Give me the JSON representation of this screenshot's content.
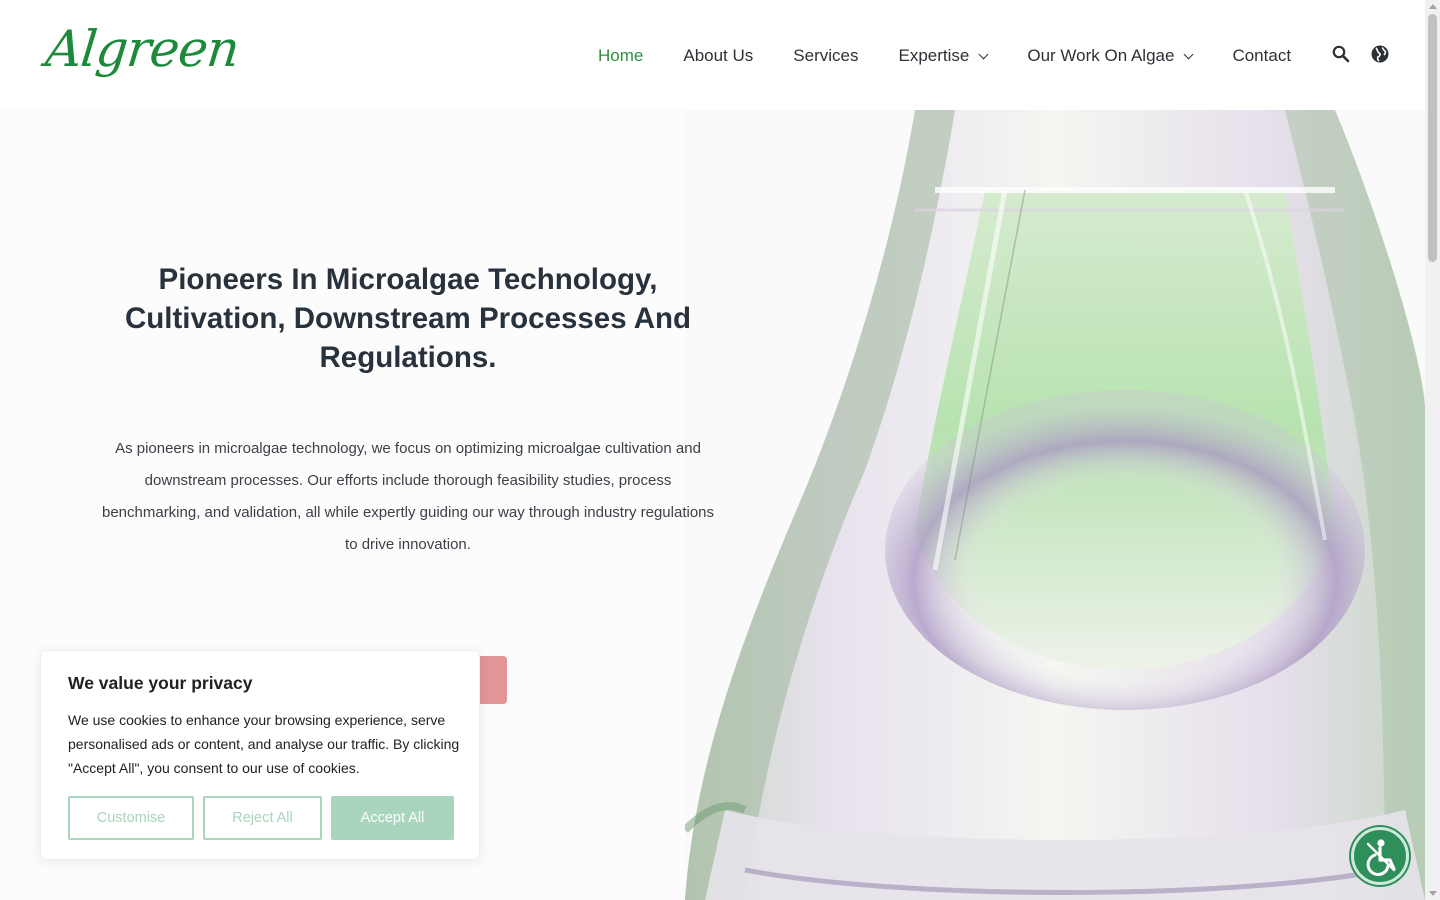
{
  "brand": {
    "logo_text": "Algreen",
    "accent": "#2f8f3f"
  },
  "nav": {
    "items": [
      {
        "label": "Home",
        "active": true,
        "dropdown": false
      },
      {
        "label": "About Us",
        "active": false,
        "dropdown": false
      },
      {
        "label": "Services",
        "active": false,
        "dropdown": false
      },
      {
        "label": "Expertise",
        "active": false,
        "dropdown": true
      },
      {
        "label": "Our Work On Algae",
        "active": false,
        "dropdown": true
      },
      {
        "label": "Contact",
        "active": false,
        "dropdown": false
      }
    ],
    "icons": [
      "search-icon",
      "globe-icon"
    ]
  },
  "hero": {
    "title": "Pioneers In Microalgae Technology, Cultivation, Downstream Processes And Regulations.",
    "text": "As pioneers in microalgae technology, we focus on optimizing microalgae cultivation and downstream processes. Our efforts include thorough feasibility studies, process benchmarking, and validation, all while expertly guiding our way through industry regulations to drive innovation.",
    "button_color": "#e29597"
  },
  "cookie": {
    "title": "We value your privacy",
    "text": "We use cookies to enhance your browsing experience, serve personalised ads or content, and analyse our traffic. By clicking \"Accept All\", you consent to our use of cookies.",
    "customise_label": "Customise",
    "reject_label": "Reject All",
    "accept_label": "Accept All",
    "button_color": "#a8d5bc"
  },
  "accessibility": {
    "icon": "accessibility-icon",
    "color": "#2f8f5a"
  }
}
